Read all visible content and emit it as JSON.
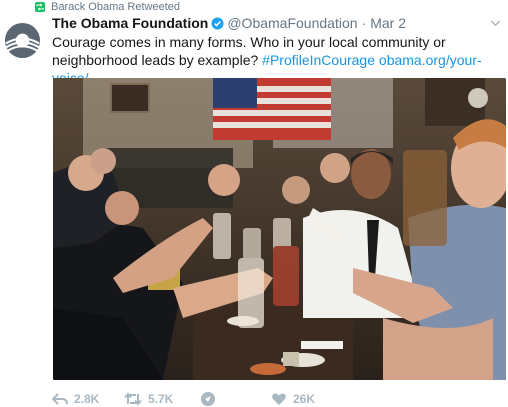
{
  "retweet_context": {
    "text": "Barack Obama Retweeted"
  },
  "tweet": {
    "display_name": "The Obama Foundation",
    "handle": "@ObamaFoundation",
    "separator": "·",
    "timestamp": "Mar 2",
    "text_plain": "Courage comes in many forms. Who in your local community or neighborhood leads by example?",
    "hashtag": "#ProfileInCourage",
    "link": "obama.org/your-voice/"
  },
  "actions": {
    "reply_count": "2.8K",
    "retweet_count": "5.7K",
    "like_count": "26K"
  },
  "icons": {
    "retweet_badge": "retweet-icon",
    "verified": "verified-badge-icon",
    "reply": "reply-icon",
    "retweet": "retweet-icon",
    "dm": "direct-message-icon",
    "like": "heart-icon",
    "more": "chevron-down-icon"
  },
  "colors": {
    "link": "#1b95e0",
    "muted": "#657786",
    "action": "#aab8c2",
    "retweet_green": "#17bf63"
  }
}
